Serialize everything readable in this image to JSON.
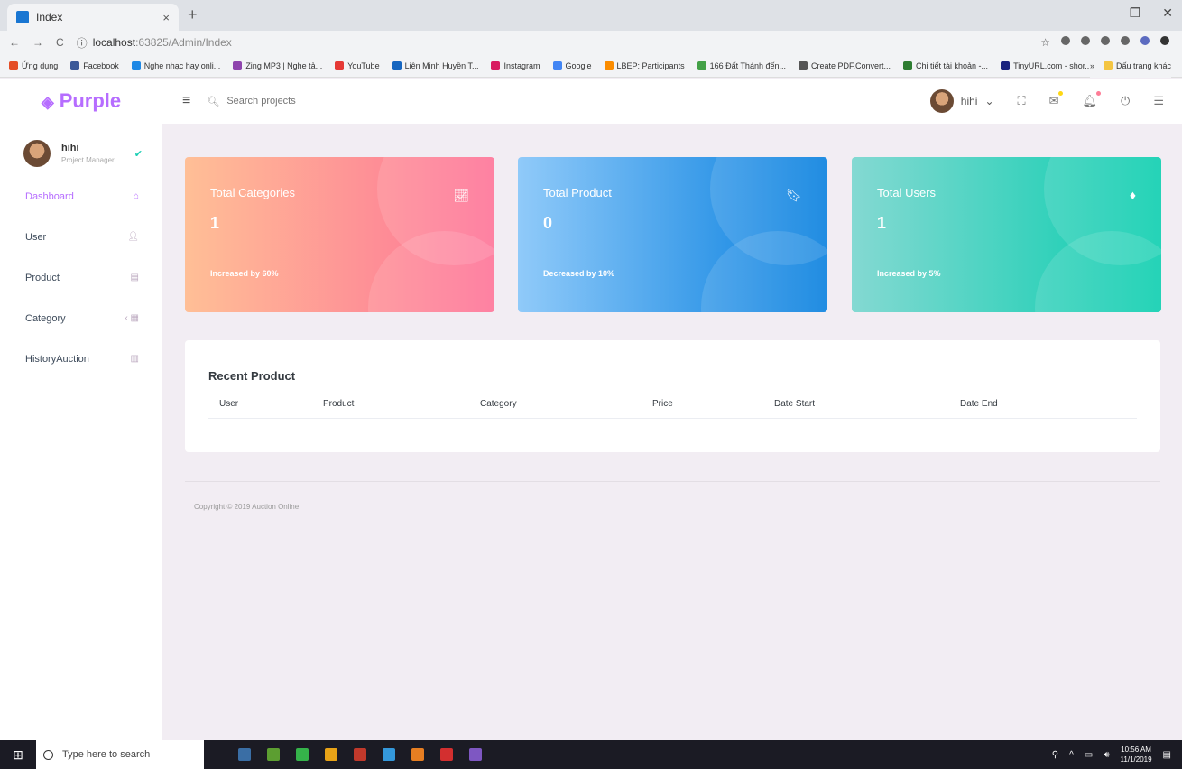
{
  "browser": {
    "tab_title": "Index",
    "tab_close": "×",
    "new_tab": "+",
    "window_controls": [
      "–",
      "❐",
      "✕"
    ],
    "nav_icons": [
      "←",
      "→",
      "C"
    ],
    "url_host": "localhost",
    "url_rest": ":63825/Admin/Index",
    "info_icon": "ⓘ",
    "star_icon": "☆",
    "bookmarks": [
      {
        "label": "Ứng dụng",
        "color": "#e44d26"
      },
      {
        "label": "Facebook",
        "color": "#3b5998"
      },
      {
        "label": "Nghe nhạc hay onli...",
        "color": "#1e88e5"
      },
      {
        "label": "Zing MP3 | Nghe tả...",
        "color": "#8e44ad"
      },
      {
        "label": "YouTube",
        "color": "#e53935"
      },
      {
        "label": "Liên Minh Huyền T...",
        "color": "#1565c0"
      },
      {
        "label": "Instagram",
        "color": "#d81b60"
      },
      {
        "label": "Google",
        "color": "#4285f4"
      },
      {
        "label": "LBEP: Participants",
        "color": "#fb8c00"
      },
      {
        "label": "166 Đất Thánh đến...",
        "color": "#43a047"
      },
      {
        "label": "Create PDF,Convert...",
        "color": "#555555"
      },
      {
        "label": "Chi tiết tài khoản -...",
        "color": "#2e7d32"
      },
      {
        "label": "TinyURL.com - shor...",
        "color": "#1a237e"
      }
    ],
    "more_bookmarks": "»",
    "other_bookmarks": "Dấu trang khác"
  },
  "topnav": {
    "brand": "Purple",
    "menu_icon": "≡",
    "search_icon": "🔍︎",
    "search_placeholder": "Search projects",
    "profile_name": "hihi",
    "chevron": "⌄",
    "fullscreen_icon": "⛶",
    "mail_icon": "✉",
    "bell_icon": "🔔︎",
    "power_icon": "⏻",
    "list_icon": "☰"
  },
  "sidebar": {
    "user_name": "hihi",
    "user_role": "Project Manager",
    "badge_icon": "✔",
    "items": [
      {
        "label": "Dashboard",
        "icon": "⌂"
      },
      {
        "label": "User",
        "icon": "👤︎"
      },
      {
        "label": "Product",
        "icon": "▤"
      },
      {
        "label": "Category",
        "icon": "‹ ▦"
      },
      {
        "label": "HistoryAuction",
        "icon": "▥"
      }
    ]
  },
  "cards": [
    {
      "title": "Total Categories",
      "value": "1",
      "sub": "Increased by 60%",
      "icon": "📈︎"
    },
    {
      "title": "Total Product",
      "value": "0",
      "sub": "Decreased by 10%",
      "icon": "🔖︎"
    },
    {
      "title": "Total Users",
      "value": "1",
      "sub": "Increased by 5%",
      "icon": "♦"
    }
  ],
  "recent": {
    "title": "Recent Product",
    "columns": [
      "User",
      "Product",
      "Category",
      "Price",
      "Date Start",
      "Date End"
    ]
  },
  "footer": "Copyright © 2019 Auction Online",
  "taskbar": {
    "start_icon": "⊞",
    "search_placeholder": "Type here to search",
    "time": "10:56 AM",
    "date": "11/1/2019",
    "apps": [
      "#3a6ea5",
      "#5c9e31",
      "#35b34a",
      "#e8a317",
      "#c0392b",
      "#3498db",
      "#e67e22",
      "#d32f2f",
      "#7e57c2"
    ]
  }
}
